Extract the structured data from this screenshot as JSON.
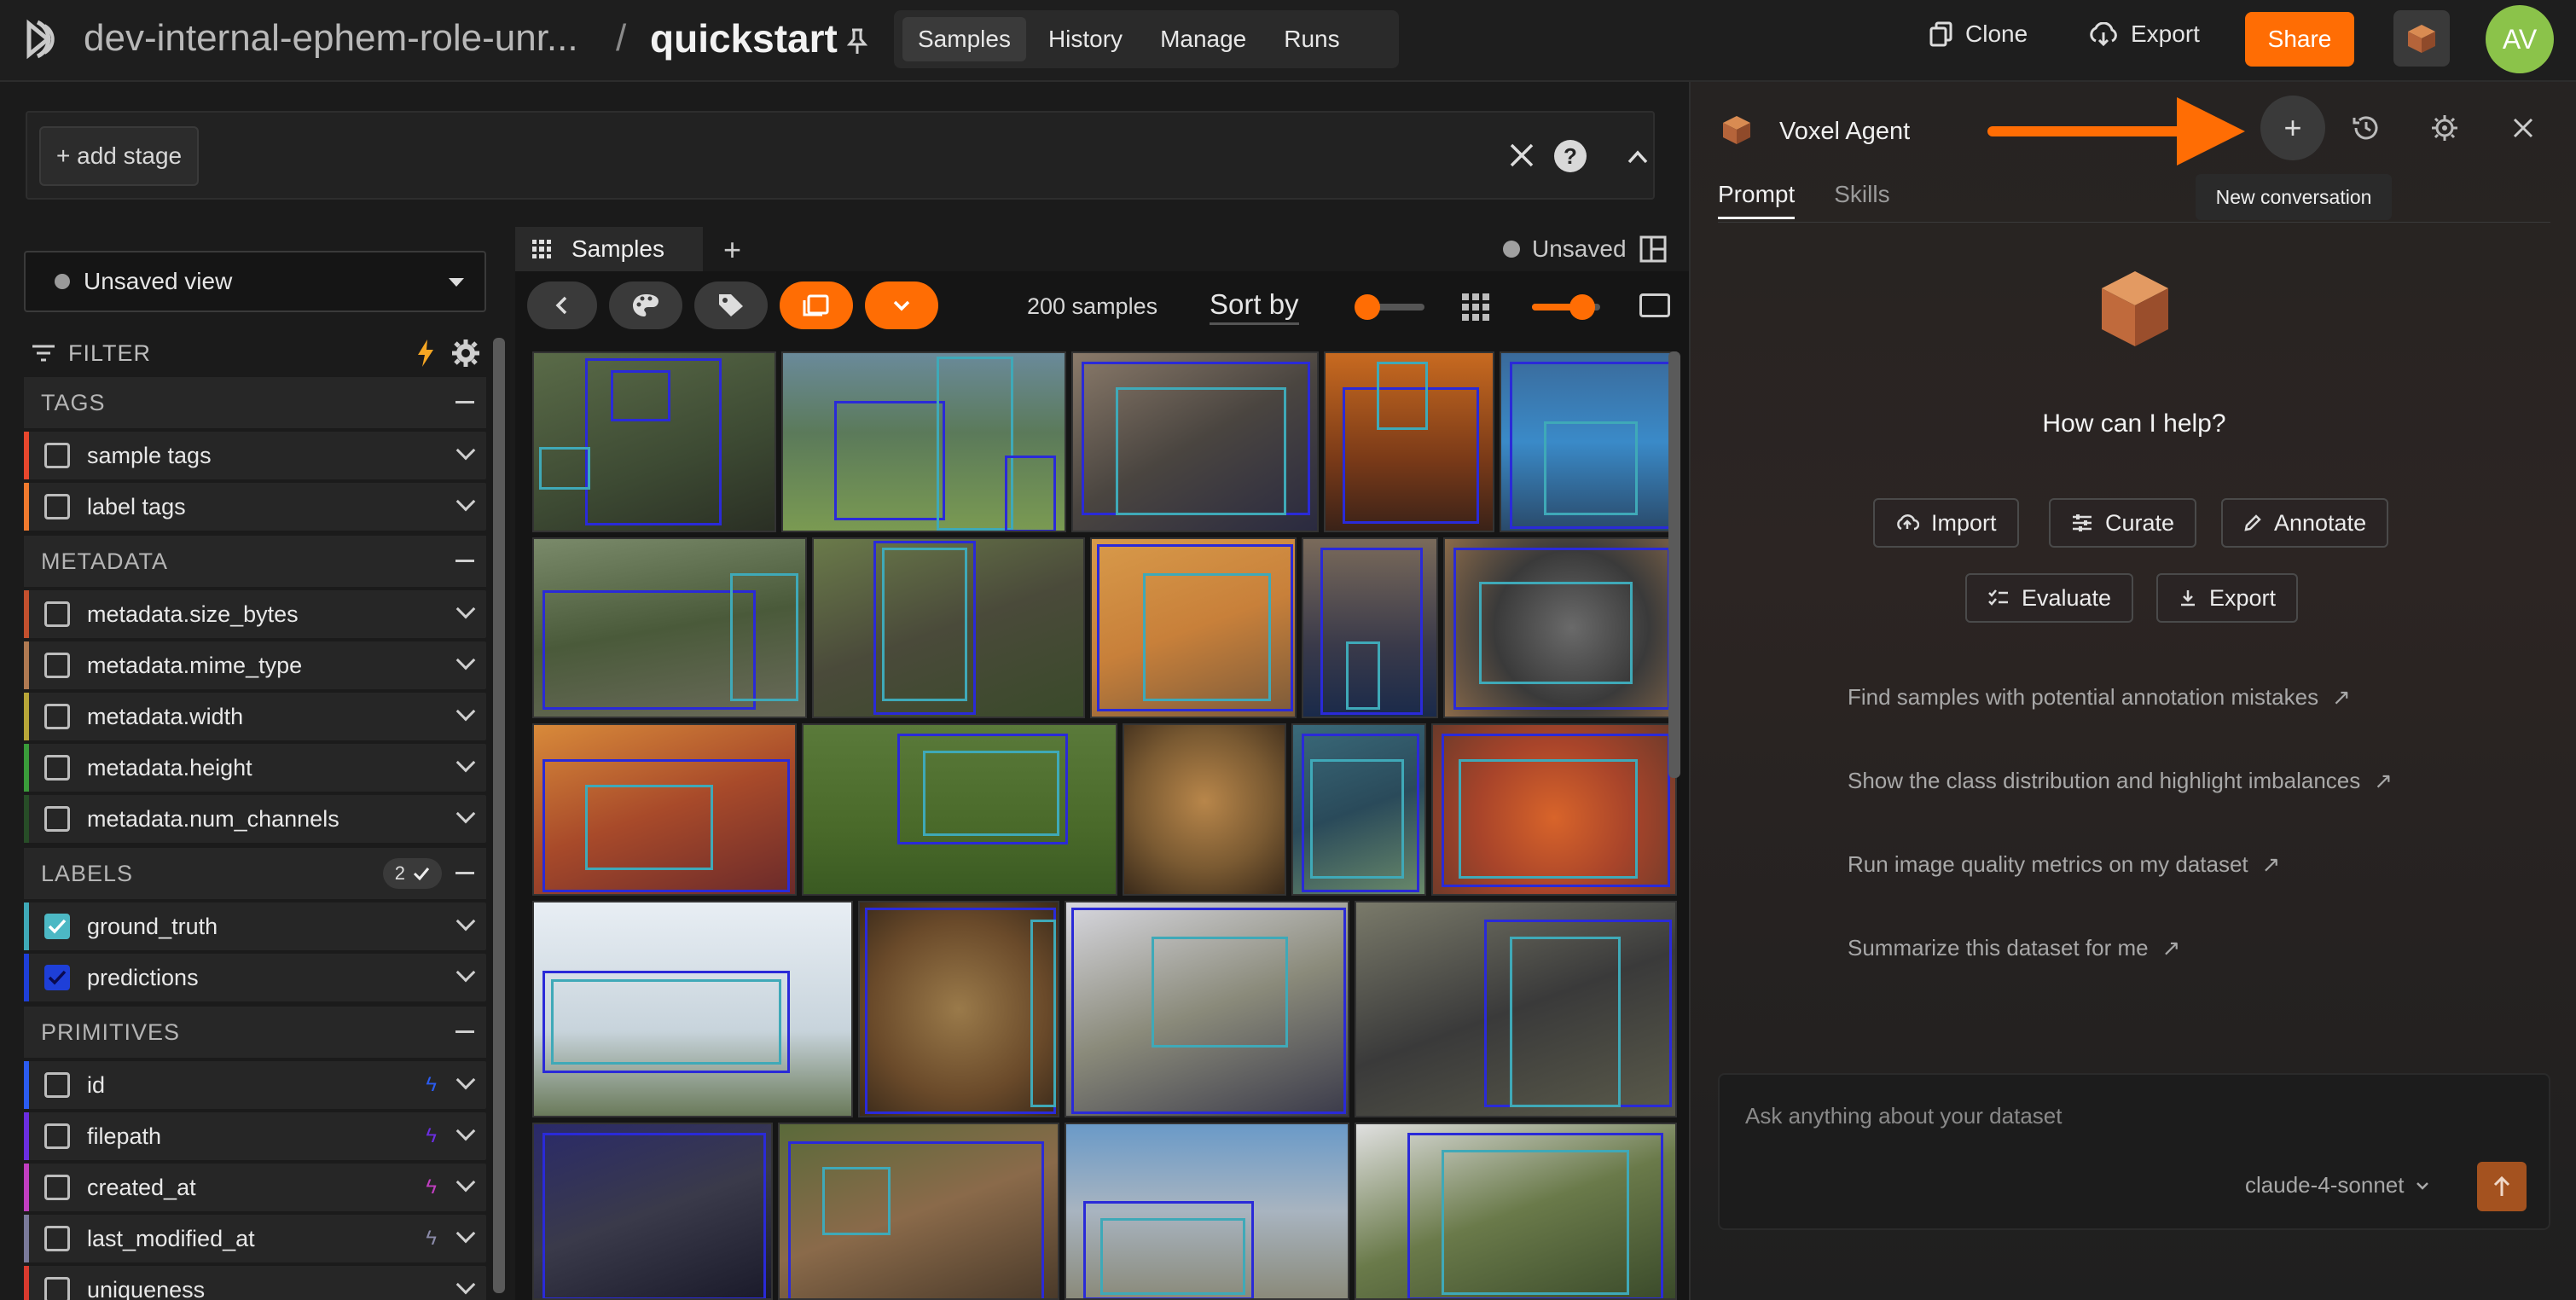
{
  "header": {
    "dataset_name": "dev-internal-ephem-role-unr...",
    "separator": "/",
    "view_name": "quickstart",
    "mode_tabs": [
      "Samples",
      "History",
      "Manage",
      "Runs"
    ],
    "clone_label": "Clone",
    "export_label": "Export",
    "share_label": "Share",
    "avatar_initials": "AV"
  },
  "stage": {
    "add_stage_label": "+ add stage"
  },
  "sidebar": {
    "view_select": "Unsaved view",
    "filter_label": "FILTER",
    "groups": [
      {
        "title": "TAGS",
        "fields": [
          {
            "label": "sample tags",
            "color": "#e8472d",
            "checked": false
          },
          {
            "label": "label tags",
            "color": "#f07a2e",
            "checked": false
          }
        ]
      },
      {
        "title": "METADATA",
        "fields": [
          {
            "label": "metadata.size_bytes",
            "color": "#c3502e",
            "checked": false
          },
          {
            "label": "metadata.mime_type",
            "color": "#b07a52",
            "checked": false
          },
          {
            "label": "metadata.width",
            "color": "#b8a638",
            "checked": false
          },
          {
            "label": "metadata.height",
            "color": "#3a9c3a",
            "checked": false
          },
          {
            "label": "metadata.num_channels",
            "color": "#274d27",
            "checked": false
          }
        ]
      },
      {
        "title": "LABELS",
        "badge": "2",
        "fields": [
          {
            "label": "ground_truth",
            "color": "#3fa9b8",
            "checked": true
          },
          {
            "label": "predictions",
            "color": "#1e3fd8",
            "checked": true
          }
        ]
      },
      {
        "title": "PRIMITIVES",
        "fields": [
          {
            "label": "id",
            "color": "#2b5cf0",
            "checked": false
          },
          {
            "label": "filepath",
            "color": "#6b2ee0",
            "checked": false
          },
          {
            "label": "created_at",
            "color": "#c03ec0",
            "checked": false
          },
          {
            "label": "last_modified_at",
            "color": "#7a7a9a",
            "checked": false
          },
          {
            "label": "uniqueness",
            "color": "#d93a2e",
            "checked": false
          }
        ]
      }
    ]
  },
  "samples": {
    "tab_label": "Samples",
    "unsaved_label": "Unsaved",
    "count_text": "200 samples",
    "sort_by_label": "Sort by"
  },
  "agent": {
    "title": "Voxel Agent",
    "tooltip": "New conversation",
    "tabs": [
      "Prompt",
      "Skills"
    ],
    "help_text": "How can I help?",
    "chips": [
      "Import",
      "Curate",
      "Annotate",
      "Evaluate",
      "Export"
    ],
    "suggestions": [
      "Find samples with potential annotation mistakes",
      "Show the class distribution and highlight imbalances",
      "Run image quality metrics on my dataset",
      "Summarize this dataset for me"
    ],
    "input_placeholder": "Ask anything about your dataset",
    "model": "claude-4-sonnet"
  },
  "colors": {
    "accent": "#ff6d04",
    "prediction_box": "#2a2ad8",
    "ground_truth_box": "#3fa9b8"
  }
}
